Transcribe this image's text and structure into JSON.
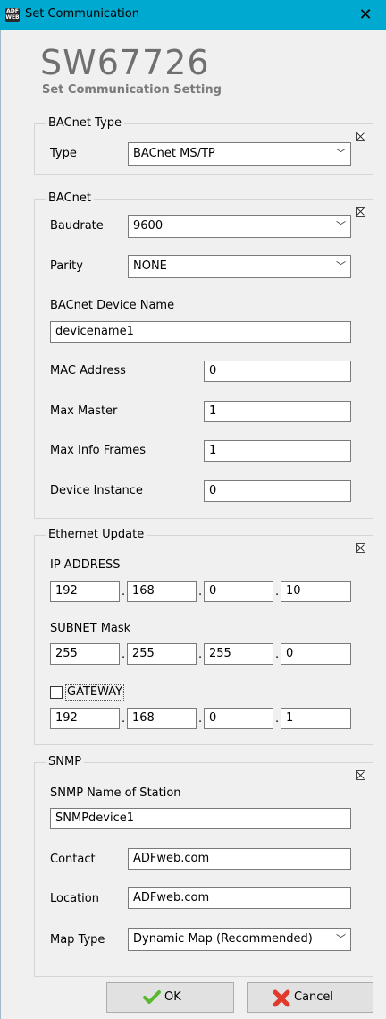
{
  "window": {
    "title": "Set Communication",
    "close_icon": "close-icon",
    "app_icon_text": [
      "ADF",
      "WEB"
    ]
  },
  "header": {
    "title": "SW67726",
    "subtitle": "Set Communication Setting"
  },
  "bacnet_type": {
    "legend": "BACnet Type",
    "type_label": "Type",
    "type_value": "BACnet MS/TP"
  },
  "bacnet": {
    "legend": "BACnet",
    "baudrate_label": "Baudrate",
    "baudrate_value": "9600",
    "parity_label": "Parity",
    "parity_value": "NONE",
    "device_name_label": "BACnet Device Name",
    "device_name_value": "devicename1",
    "mac_label": "MAC Address",
    "mac_value": "0",
    "max_master_label": "Max Master",
    "max_master_value": "1",
    "max_info_label": "Max Info Frames",
    "max_info_value": "1",
    "device_instance_label": "Device Instance",
    "device_instance_value": "0"
  },
  "ethernet": {
    "legend": "Ethernet Update",
    "ip_label": "IP ADDRESS",
    "ip": [
      "192",
      "168",
      "0",
      "10"
    ],
    "subnet_label": "SUBNET Mask",
    "subnet": [
      "255",
      "255",
      "255",
      "0"
    ],
    "gateway_label": "GATEWAY",
    "gateway_checked": false,
    "gateway": [
      "192",
      "168",
      "0",
      "1"
    ],
    "separator": "."
  },
  "snmp": {
    "legend": "SNMP",
    "station_label": "SNMP Name of Station",
    "station_value": "SNMPdevice1",
    "contact_label": "Contact",
    "contact_value": "ADFweb.com",
    "location_label": "Location",
    "location_value": "ADFweb.com",
    "map_type_label": "Map Type",
    "map_type_value": "Dynamic Map (Recommended)"
  },
  "buttons": {
    "ok_label": "OK",
    "cancel_label": "Cancel"
  },
  "colors": {
    "titlebar": "#00a9cf",
    "ok_check": "#5cb82e",
    "cancel_x": "#e03a2a"
  }
}
